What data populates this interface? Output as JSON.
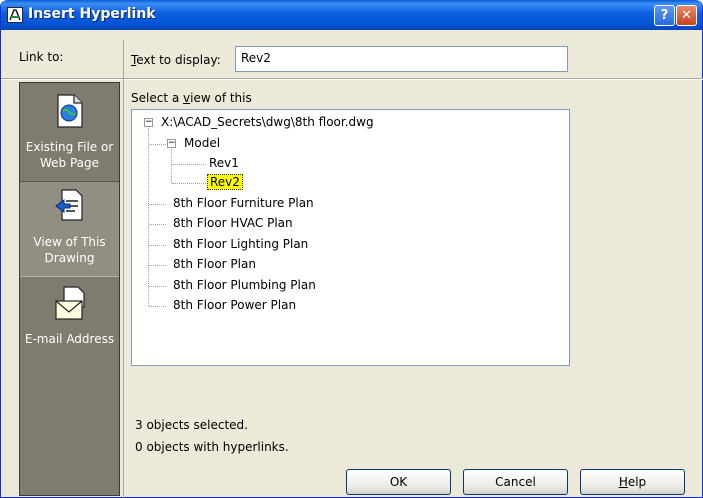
{
  "window": {
    "title": "Insert Hyperlink"
  },
  "titlebar": {
    "help_glyph": "?",
    "close_glyph": "✕"
  },
  "link_to": {
    "label": "Link to:",
    "items": [
      {
        "label_line1": "Existing File or",
        "label_line2": "Web Page",
        "icon": "globe-document-icon",
        "selected": false
      },
      {
        "label_line1": "View of This",
        "label_line2": "Drawing",
        "icon": "drawing-view-icon",
        "selected": true
      },
      {
        "label_line1": "E-mail Address",
        "label_line2": "",
        "icon": "envelope-icon",
        "selected": false
      }
    ]
  },
  "text_to_display": {
    "label_pre": "",
    "label_mnemonic": "T",
    "label_post": "ext to display:",
    "value": "Rev2"
  },
  "select_view": {
    "label_pre": "Select a ",
    "label_mnemonic": "v",
    "label_post": "iew of this"
  },
  "tree": {
    "root": "X:\\ACAD_Secrets\\dwg\\8th floor.dwg",
    "model": "Model",
    "rev1": "Rev1",
    "rev2": "Rev2",
    "layouts": [
      "8th Floor Furniture Plan",
      "8th Floor HVAC Plan",
      "8th Floor Lighting Plan",
      "8th Floor Plan",
      "8th Floor Plumbing Plan",
      "8th Floor Power Plan"
    ]
  },
  "status": {
    "selected": "3 objects selected.",
    "hyperlinks": "0 objects with hyperlinks."
  },
  "buttons": {
    "ok": "OK",
    "cancel": "Cancel",
    "help_mnemonic": "H",
    "help_rest": "elp"
  },
  "colors": {
    "titlebar": "#0b5fe0",
    "panel": "#7f7c6f",
    "highlight": "#ffff00"
  }
}
